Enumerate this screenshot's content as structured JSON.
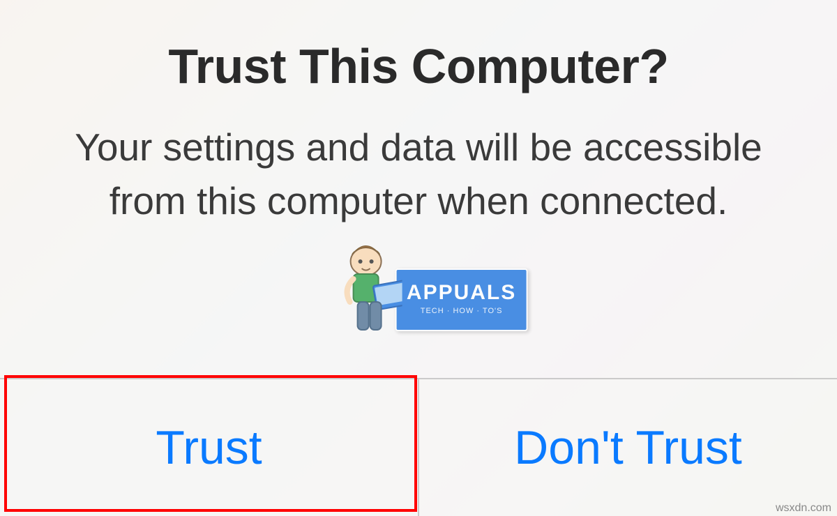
{
  "dialog": {
    "title": "Trust This Computer?",
    "message": "Your settings and data will be accessible from this computer when connected.",
    "buttons": {
      "trust": "Trust",
      "dont_trust": "Don't Trust"
    }
  },
  "watermark": {
    "brand": "APPUALS",
    "tagline": "TECH · HOW · TO'S"
  },
  "source": "wsxdn.com"
}
